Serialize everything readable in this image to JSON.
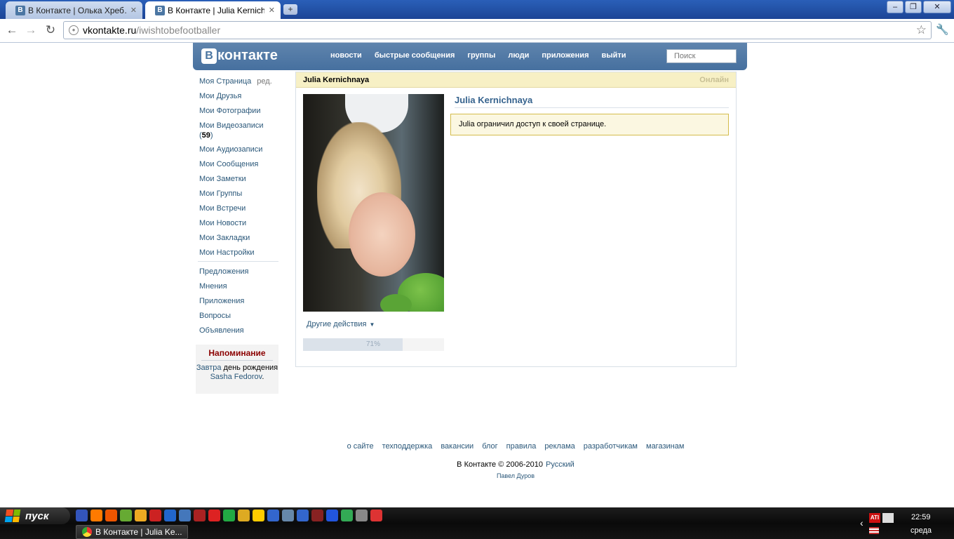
{
  "browser": {
    "tabs": [
      {
        "title": "В Контакте | Олька Хреб…",
        "favicon": "В",
        "active": false
      },
      {
        "title": "В Контакте | Julia Kernich…",
        "favicon": "В",
        "active": true
      }
    ],
    "url_domain": "vkontakte.ru",
    "url_path": "/iwishtobefootballer",
    "icons": [
      "back-icon",
      "forward-icon",
      "reload-icon",
      "globe-icon",
      "star-icon",
      "wrench-icon",
      "new-tab-icon",
      "minimize-icon",
      "maximize-icon",
      "close-icon"
    ]
  },
  "header": {
    "logo_letter": "В",
    "logo_text": "контакте",
    "menu": [
      "новости",
      "быстрые сообщения",
      "группы",
      "люди",
      "приложения",
      "выйти"
    ],
    "search_placeholder": "Поиск"
  },
  "sidebar": {
    "items": [
      {
        "label": "Моя Страница",
        "extra": "ред."
      },
      {
        "label": "Мои Друзья"
      },
      {
        "label": "Мои Фотографии"
      },
      {
        "label": "Мои Видеозаписи",
        "count": "59"
      },
      {
        "label": "Мои Аудиозаписи"
      },
      {
        "label": "Мои Сообщения"
      },
      {
        "label": "Мои Заметки"
      },
      {
        "label": "Мои Группы"
      },
      {
        "label": "Мои Встречи"
      },
      {
        "label": "Мои Новости"
      },
      {
        "label": "Мои Закладки"
      },
      {
        "label": "Мои Настройки"
      }
    ],
    "items2": [
      "Предложения",
      "Мнения",
      "Приложения",
      "Вопросы",
      "Объявления"
    ],
    "reminder": {
      "title": "Напоминание",
      "when": "Завтра",
      "text": "день рождения",
      "person": "Sasha Fedorov",
      "end": "."
    }
  },
  "profile": {
    "header_name": "Julia Kernichnaya",
    "status": "Онлайн",
    "name": "Julia Kernichnaya",
    "notice": "Julia ограничил доступ к своей странице.",
    "actions_label": "Другие действия",
    "progress_percent": 71,
    "progress_label": "71%"
  },
  "footer": {
    "links": [
      "о сайте",
      "техподдержка",
      "вакансии",
      "блог",
      "правила",
      "реклама",
      "разработчикам",
      "магазинам"
    ],
    "copyright": "В Контакте © 2006-2010",
    "language": "Русский",
    "author": "Павел Дуров"
  },
  "taskbar": {
    "start_label": "пуск",
    "task_title": "В Контакте | Julia Ke...",
    "time": "22:59",
    "day": "среда",
    "quicklaunch_colors": [
      "#3355bb",
      "#ff7a00",
      "#ee5500",
      "#66aa33",
      "#eeaa22",
      "#cc2222",
      "#2266cc",
      "#4477bb",
      "#aa2222",
      "#dd2222",
      "#22aa44",
      "#ddaa22",
      "#ffcc00",
      "#3366cc",
      "#6688aa",
      "#3366cc",
      "#882222",
      "#2255dd",
      "#33aa55",
      "#888888",
      "#dd3333"
    ],
    "colors": {
      "flag_red": "#f25022",
      "flag_green": "#7fba00",
      "flag_blue": "#00a4ef",
      "flag_yellow": "#ffb900"
    }
  }
}
